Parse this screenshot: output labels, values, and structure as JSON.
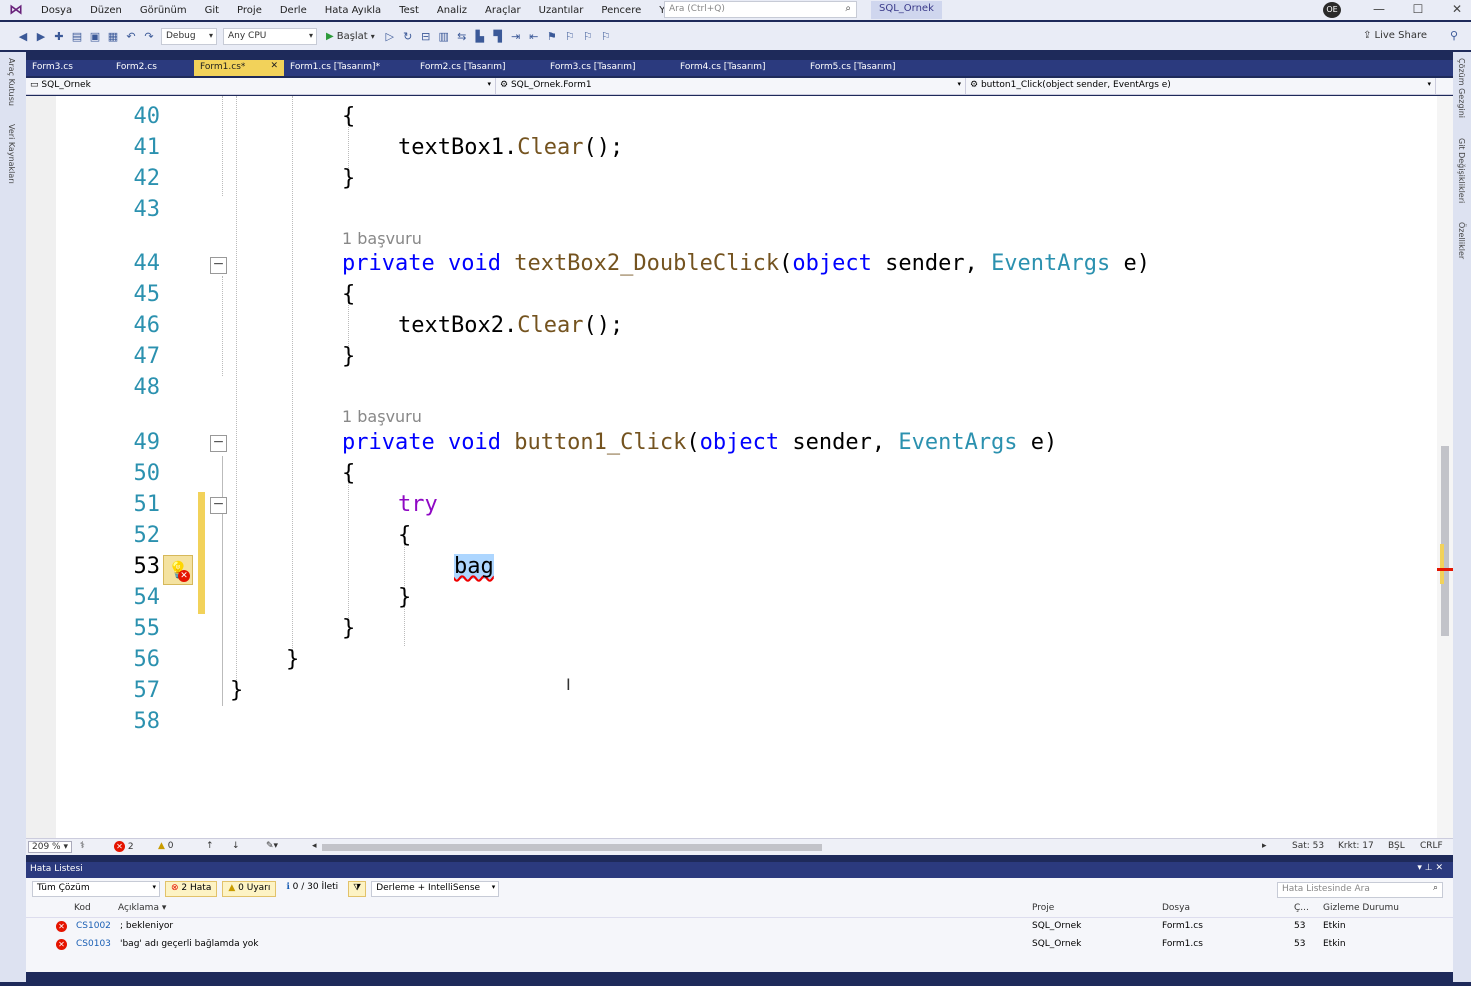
{
  "menu": [
    "Dosya",
    "Düzen",
    "Görünüm",
    "Git",
    "Proje",
    "Derle",
    "Hata Ayıkla",
    "Test",
    "Analiz",
    "Araçlar",
    "Uzantılar",
    "Pencere",
    "Yardım"
  ],
  "search": {
    "placeholder": "Ara (Ctrl+Q)"
  },
  "solution_name": "SQL_Ornek",
  "avatar_initials": "OE",
  "toolbar": {
    "config": "Debug",
    "platform": "Any CPU",
    "start": "Başlat",
    "live_share": "Live Share"
  },
  "left_strip": [
    "Araç Kutusu",
    "Veri Kaynakları"
  ],
  "right_strip": [
    "Çözüm Gezgini",
    "Git Değişiklikleri",
    "Özellikler"
  ],
  "tabs": [
    {
      "label": "Form3.cs"
    },
    {
      "label": "Form2.cs"
    },
    {
      "label": "Form1.cs*",
      "active": true
    },
    {
      "label": "Form1.cs [Tasarım]*"
    },
    {
      "label": "Form2.cs [Tasarım]"
    },
    {
      "label": "Form3.cs [Tasarım]"
    },
    {
      "label": "Form4.cs [Tasarım]"
    },
    {
      "label": "Form5.cs [Tasarım]"
    }
  ],
  "navbar": {
    "project": "SQL_Ornek",
    "class": "SQL_Ornek.Form1",
    "member": "button1_Click(object sender, EventArgs e)"
  },
  "code": {
    "lines": [
      "40",
      "41",
      "42",
      "43",
      "44",
      "45",
      "46",
      "47",
      "48",
      "49",
      "50",
      "51",
      "52",
      "53",
      "54",
      "55",
      "56",
      "57",
      "58"
    ],
    "current_line": "53",
    "codelens": "1 başvuru",
    "l40": "{",
    "l41_obj": "textBox1",
    "l41_dot": ".",
    "l41_fn": "Clear",
    "l41_end": "();",
    "l42": "}",
    "l44_kw1": "private",
    "l44_kw2": "void",
    "l44_fn": "textBox2_DoubleClick",
    "l44_p1": "(",
    "l44_kw3": "object",
    "l44_a1": " sender, ",
    "l44_ty": "EventArgs",
    "l44_a2": " e)",
    "l45": "{",
    "l46_obj": "textBox2",
    "l46_dot": ".",
    "l46_fn": "Clear",
    "l46_end": "();",
    "l47": "}",
    "l49_kw1": "private",
    "l49_kw2": "void",
    "l49_fn": "button1_Click",
    "l49_p1": "(",
    "l49_kw3": "object",
    "l49_a1": " sender, ",
    "l49_ty": "EventArgs",
    "l49_a2": " e)",
    "l50": "{",
    "l51": "try",
    "l52": "{",
    "l53": "bag",
    "l54": "}",
    "l55": "}",
    "l56": "}",
    "l57": "}"
  },
  "editor_status": {
    "zoom": "209 %",
    "errors": "2",
    "warnings": "0",
    "line": "Sat: 53",
    "col": "Krkt: 17",
    "mode": "BŞL",
    "eol": "CRLF"
  },
  "error_list": {
    "title": "Hata Listesi",
    "scope": "Tüm Çözüm",
    "errors_btn": "2 Hata",
    "warnings_btn": "0 Uyarı",
    "messages_btn": "0 / 30 İleti",
    "build_filter": "Derleme + IntelliSense",
    "search_placeholder": "Hata Listesinde Ara",
    "columns": {
      "code": "Kod",
      "desc": "Açıklama",
      "project": "Proje",
      "file": "Dosya",
      "line": "Ç...",
      "suppression": "Gizleme Durumu"
    },
    "rows": [
      {
        "code": "CS1002",
        "desc": "; bekleniyor",
        "project": "SQL_Ornek",
        "file": "Form1.cs",
        "line": "53",
        "state": "Etkin"
      },
      {
        "code": "CS0103",
        "desc": "'bag' adı geçerli bağlamda yok",
        "project": "SQL_Ornek",
        "file": "Form1.cs",
        "line": "53",
        "state": "Etkin"
      }
    ]
  }
}
